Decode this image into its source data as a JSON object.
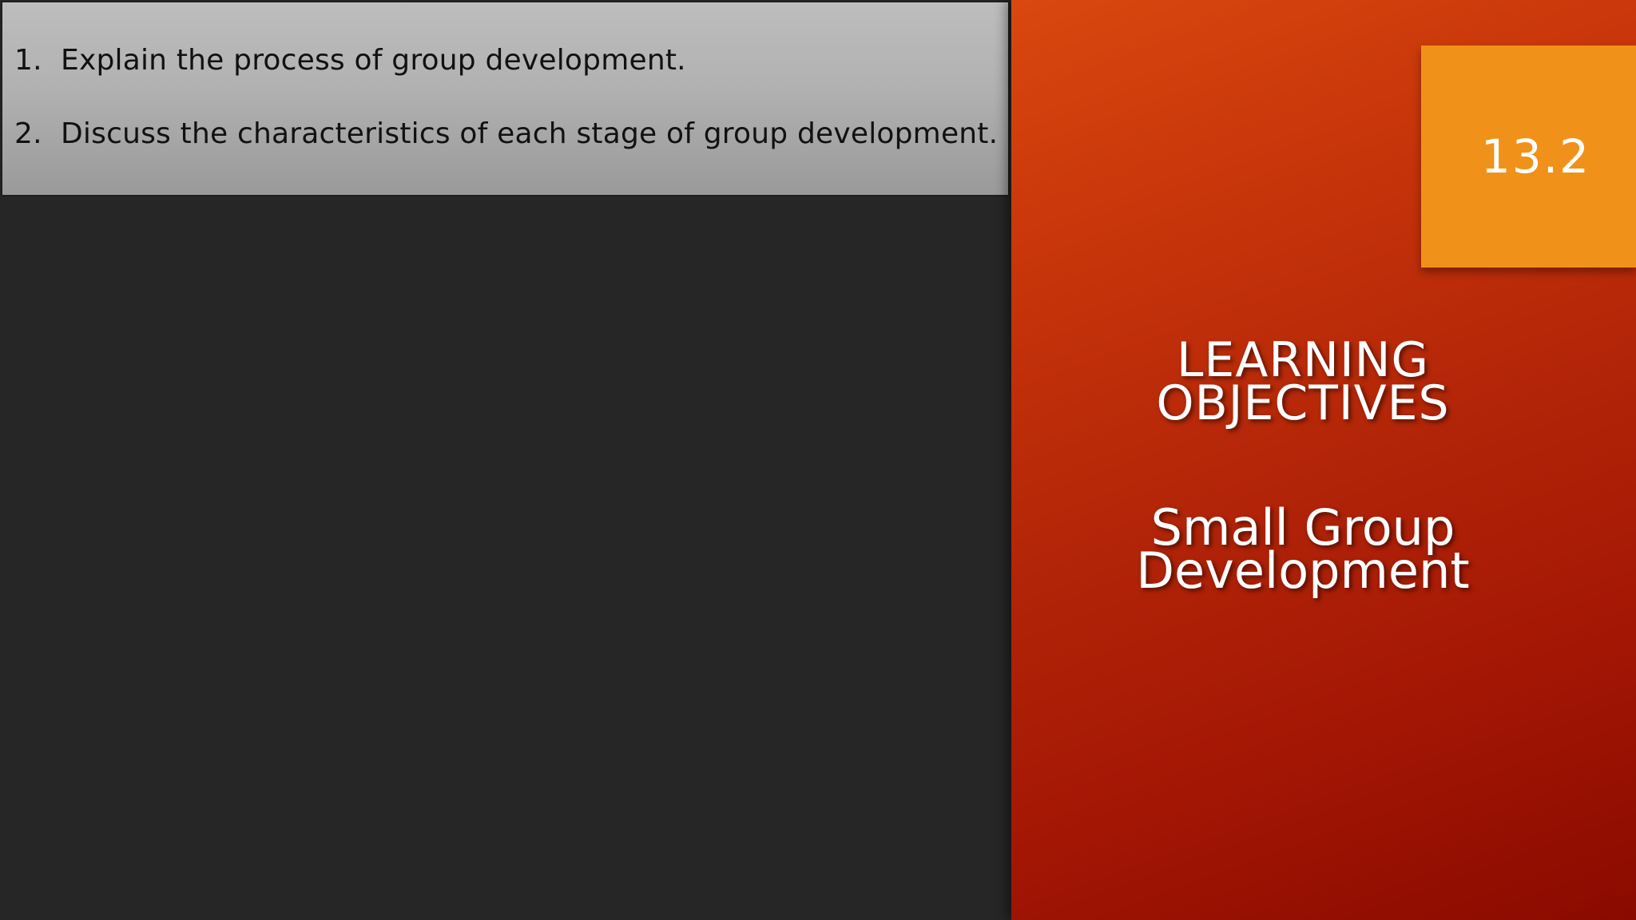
{
  "objectives": {
    "items": [
      {
        "number": "1.",
        "text": "Explain the process of group development."
      },
      {
        "number": "2.",
        "text": "Discuss the characteristics of each stage of group development."
      }
    ]
  },
  "section": {
    "number": "13.2"
  },
  "heading": {
    "title_lines": [
      "LEARNING",
      "OBJECTIVES"
    ],
    "subtitle_lines": [
      "Small Group",
      "Development"
    ]
  },
  "colors": {
    "objectives_box": "#b3b3b3",
    "background": "#262626",
    "panel_accent": "#c6340a",
    "badge": "#f0921a"
  }
}
